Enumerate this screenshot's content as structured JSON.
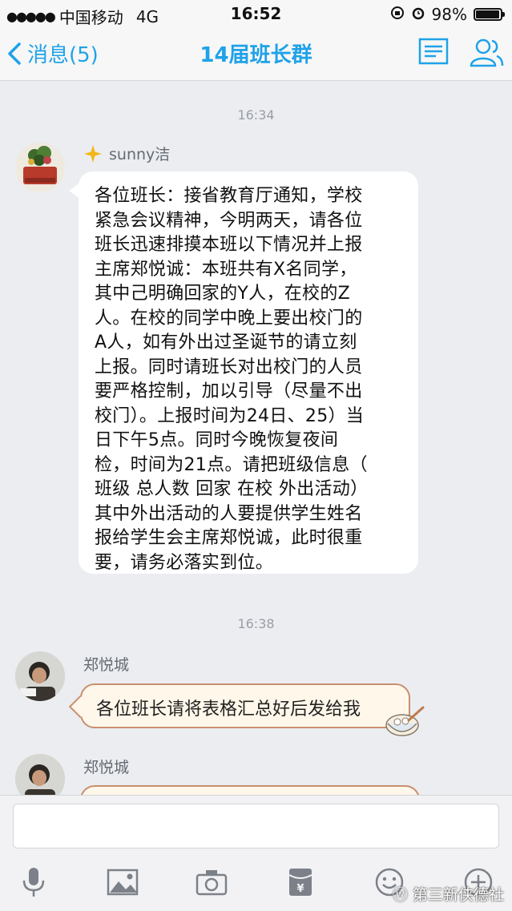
{
  "status_bar": {
    "carrier": "中国移动",
    "network": "4G",
    "time": "16:52",
    "battery_percent": "98%",
    "battery_level": 0.98
  },
  "nav": {
    "back_label": "消息(5)",
    "title": "14届班长群",
    "icons": [
      "group-notice-icon",
      "group-members-icon"
    ]
  },
  "chat": {
    "messages": [
      {
        "time": "16:34",
        "sender": "sunny洁",
        "lines": [
          "各位班长：接省教育厅通知，学校",
          "紧急会议精神，今明两天，请各位",
          "班长迅速排摸本班以下情况并上报",
          "主席郑悦诚：本班共有X名同学，",
          "其中己明确回家的Y人，在校的Z",
          "人。在校的同学中晚上要出校门的",
          "A人，如有外出过圣诞节的请立刻",
          "上报。同时请班长对出校门的人员",
          "要严格控制，加以引导（尽量不出",
          "校门）。上报时间为24日、25）当",
          "日下午5点。同时今晚恢复夜间",
          "检，时间为21点。请把班级信息（",
          "班级 总人数 回家 在校  外出活动）",
          "其中外出活动的人要提供学生姓名",
          "报给学生会主席郑悦诚，此时很重",
          "要，请务必落实到位。"
        ]
      },
      {
        "time": "16:38",
        "sender": "郑悦城",
        "text": "各位班长请将表格汇总好后发给我"
      },
      {
        "sender": "郑悦城",
        "text": ""
      }
    ]
  },
  "input": {
    "value": "",
    "toolbar": [
      "mic-icon",
      "image-icon",
      "camera-icon",
      "red-packet-icon",
      "emoji-icon",
      "plus-icon"
    ]
  },
  "watermark": "第三新侠德社",
  "colors": {
    "accent": "#1fa2e8",
    "background": "#ebedf1",
    "bubble_border": "#c98f6e"
  }
}
